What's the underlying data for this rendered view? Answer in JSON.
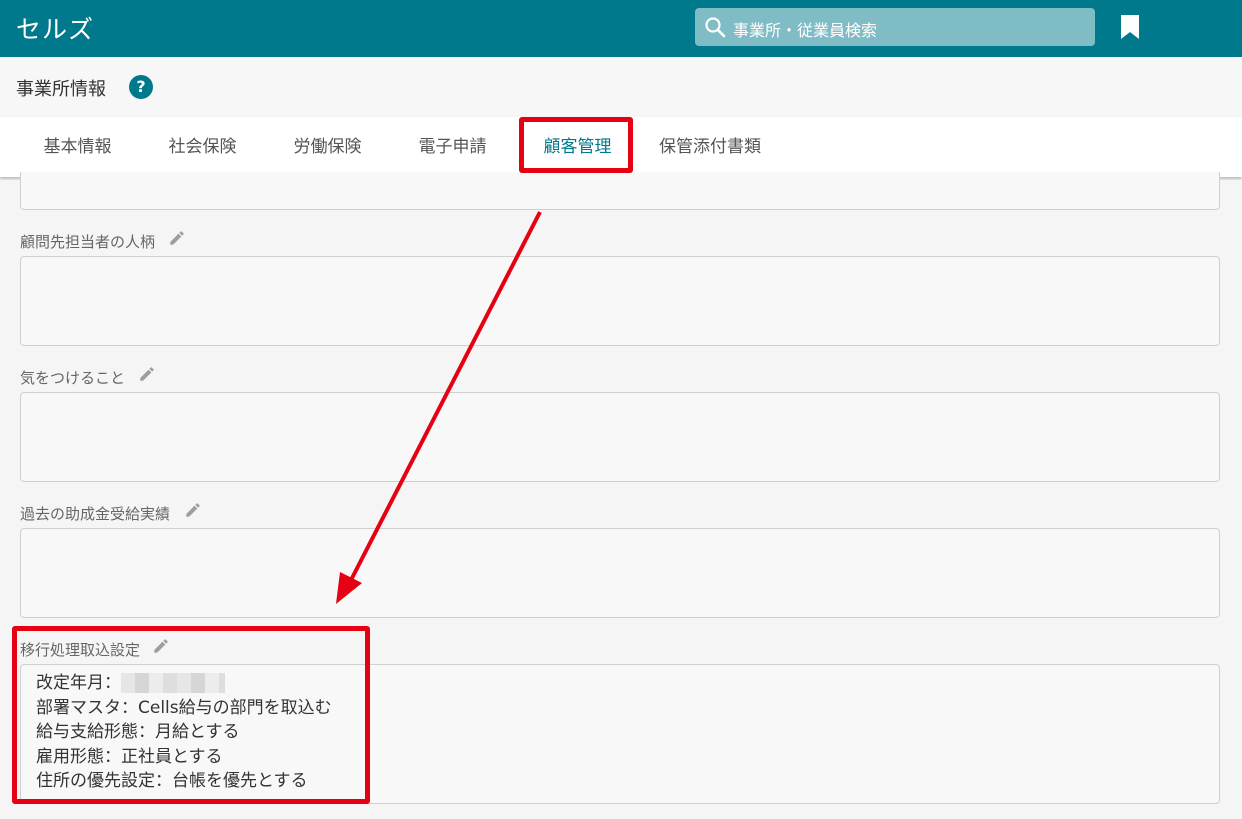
{
  "app": {
    "title": "セルズ"
  },
  "header": {
    "search_placeholder": "事業所・従業員検索"
  },
  "page": {
    "title": "事業所情報",
    "help_label": "?"
  },
  "tabs": [
    {
      "label": "基本情報"
    },
    {
      "label": "社会保険"
    },
    {
      "label": "労働保険"
    },
    {
      "label": "電子申請"
    },
    {
      "label": "顧客管理",
      "active": true
    },
    {
      "label": "保管添付書類"
    }
  ],
  "fields": [
    {
      "label": "顧問先担当者の人柄",
      "value": ""
    },
    {
      "label": "気をつけること",
      "value": ""
    },
    {
      "label": "過去の助成金受給実績",
      "value": ""
    },
    {
      "label": "移行処理取込設定",
      "lines": [
        "改定年月：",
        "部署マスタ：Cells給与の部門を取込む",
        "給与支給形態：月給とする",
        "雇用形態：正社員とする",
        "住所の優先設定：台帳を優先とする"
      ]
    }
  ],
  "colors": {
    "brand": "#00798c",
    "annotation": "#e50012"
  }
}
